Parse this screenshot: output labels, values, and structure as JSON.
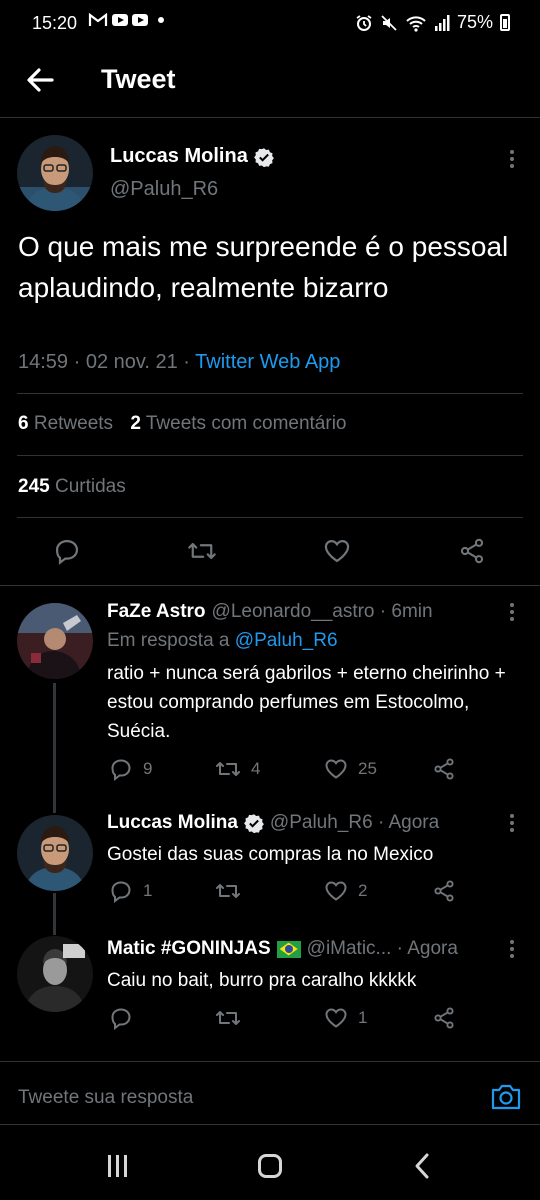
{
  "status_bar": {
    "time": "15:20",
    "battery": "75%",
    "icons": [
      "gmail-icon",
      "youtube-icon",
      "youtube-icon",
      "notification-dot",
      "alarm-icon",
      "mute-icon",
      "wifi-icon",
      "signal-icon",
      "battery-icon"
    ]
  },
  "header": {
    "title": "Tweet"
  },
  "main_tweet": {
    "author_name": "Luccas Molina",
    "handle": "@Paluh_R6",
    "text": "O que mais me surpreende é o pessoal aplaudindo, realmente bizarro",
    "time": "14:59 · 02 nov. 21 · ",
    "source": "Twitter Web App",
    "retweets_count": "6",
    "retweets_label": "Retweets",
    "quotes_count": "2",
    "quotes_label": "Tweets com comentário",
    "likes_count": "245",
    "likes_label": "Curtidas"
  },
  "replies": [
    {
      "name": "FaZe Astro",
      "handle_time": "@Leonardo__astro · 6min",
      "reply_to_label": "Em resposta a ",
      "reply_to_handle": "@Paluh_R6",
      "text": "ratio + nunca será gabrilos + eterno cheirinho + estou comprando perfumes em Estocolmo, Suécia.",
      "replies_count": "9",
      "retweets_count": "4",
      "likes_count": "25"
    },
    {
      "name": "Luccas Molina",
      "handle_time": "@Paluh_R6 · Agora",
      "text": "Gostei das suas compras la no Mexico",
      "replies_count": "1",
      "retweets_count": "",
      "likes_count": "2"
    },
    {
      "name": "Matic #GONINJAS",
      "handle_time": "@iMatic... · Agora",
      "text": "Caiu no bait, burro pra caralho kkkkk",
      "replies_count": "",
      "retweets_count": "",
      "likes_count": "1"
    }
  ],
  "compose": {
    "placeholder": "Tweete sua resposta"
  },
  "colors": {
    "background": "#000000",
    "accent": "#1d9bf0",
    "muted": "#71767b",
    "divider": "#2f3336"
  }
}
